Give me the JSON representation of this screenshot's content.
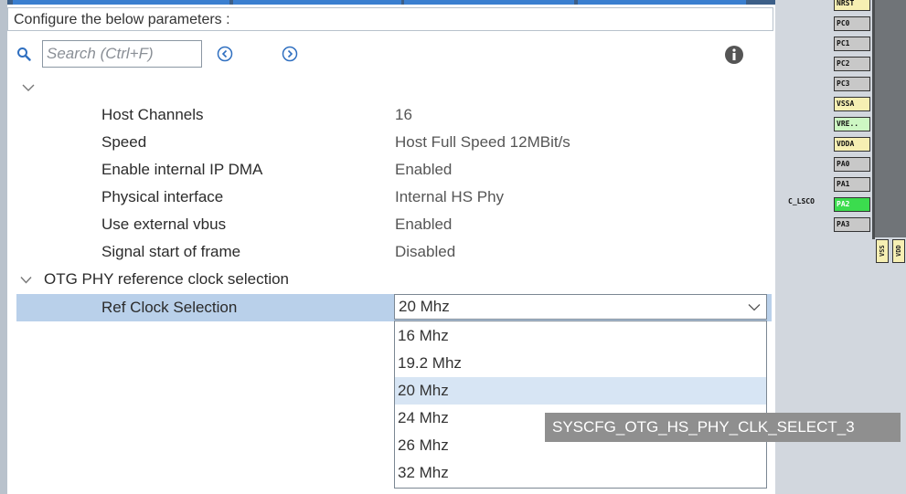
{
  "header": {
    "config_title": "Configure the below parameters :"
  },
  "search": {
    "placeholder": "Search (Ctrl+F)"
  },
  "params": [
    {
      "label": "Host Channels",
      "value": "16"
    },
    {
      "label": "Speed",
      "value": "Host Full Speed 12MBit/s"
    },
    {
      "label": "Enable internal IP DMA",
      "value": "Enabled"
    },
    {
      "label": "Physical interface",
      "value": "Internal HS Phy"
    },
    {
      "label": "Use external vbus",
      "value": "Enabled"
    },
    {
      "label": "Signal start of frame",
      "value": "Disabled"
    }
  ],
  "group": {
    "label": "OTG PHY reference clock selection"
  },
  "ref_clock": {
    "label": "Ref Clock Selection",
    "selected": "20 Mhz",
    "options": [
      "16 Mhz",
      "19.2 Mhz",
      "20 Mhz",
      "24 Mhz",
      "26 Mhz",
      "32 Mhz"
    ],
    "highlighted_index": 2
  },
  "tooltip": {
    "text": "SYSCFG_OTG_HS_PHY_CLK_SELECT_3"
  },
  "chip": {
    "pins": [
      "NRST",
      "PC0",
      "PC1",
      "PC2",
      "PC3",
      "VSSA",
      "VRE..",
      "VDDA",
      "PA0",
      "PA1",
      "PA2",
      "PA3"
    ],
    "pa2_signal": "C_LSCO",
    "bottom_pins": [
      "VSS",
      "VDD"
    ]
  },
  "colors": {
    "accent_blue": "#3a7fd0",
    "selection": "#b9d0ea",
    "pin_green": "#3bdc4e",
    "pin_yellow": "#f6efb3"
  }
}
